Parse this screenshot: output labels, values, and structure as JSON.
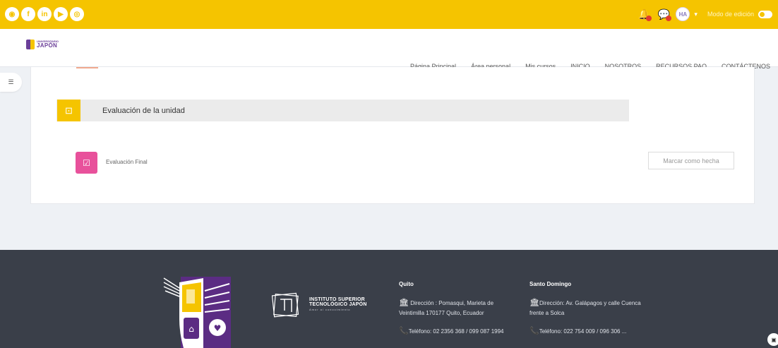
{
  "topbar": {
    "social_icons": [
      "globe-icon",
      "facebook-icon",
      "linkedin-icon",
      "youtube-icon",
      "instagram-icon"
    ],
    "social_glyphs": [
      "◉",
      "f",
      "in",
      "▶",
      "◎"
    ],
    "avatar_initials": "HA",
    "edit_mode_label": "Modo de edición",
    "colors": {
      "bar": "#f5c400",
      "badge": "#e23b2e"
    }
  },
  "brand": {
    "line1": "UNIVERSITARIO",
    "line2": "JAPÓN"
  },
  "nav": {
    "items": [
      "Página Principal",
      "Área personal",
      "Mis cursos",
      "INICIO",
      "NOSOTROS",
      "RECURSOS PAO",
      "CONTÁCTENOS"
    ]
  },
  "course": {
    "section_title": "Evaluación de la unidad",
    "activity_title": "Evaluación Final",
    "mark_done_label": "Marcar como hecha",
    "colors": {
      "section_icon": "#f5c400",
      "activity_icon": "#e8519b"
    }
  },
  "footer": {
    "institute": {
      "line1": "INSTITUTO SUPERIOR",
      "line2": "TECNOLÓGICO JAPÓN",
      "tagline": "Amor al conocimiento"
    },
    "quito": {
      "title": "Quito",
      "address": "Dirección : Pomasqui, Marieta de Veintimilla 170177 Quito, Ecuador",
      "phone": "Teléfono: 02 2356 368 / 099 087 1994"
    },
    "santo_domingo": {
      "title": "Santo Domingo",
      "address": "Dirección: Av. Galápagos y calle Cuenca frente a Solca",
      "phone": "Teléfono: 022 754 009 / 096 306 ..."
    },
    "colors": {
      "background": "#3a3f49",
      "crest_purple": "#5b2c83"
    }
  }
}
